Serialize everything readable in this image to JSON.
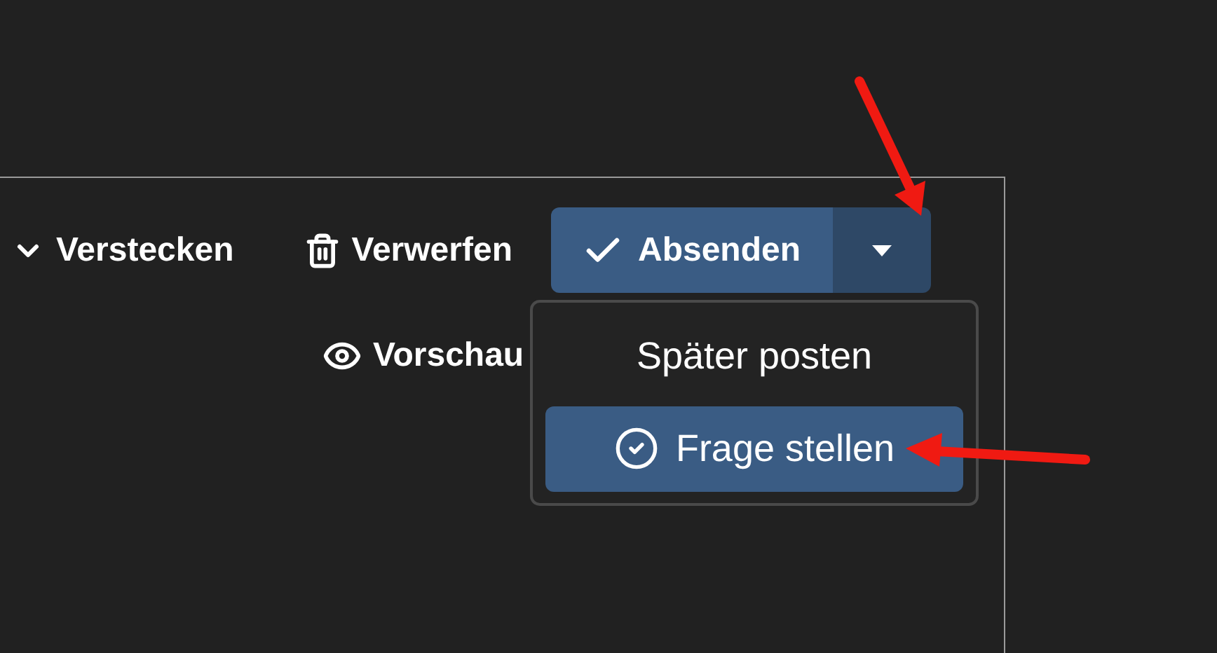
{
  "toolbar": [
    {
      "kind": "toggle",
      "label": "Verstecken"
    },
    {
      "kind": "discard",
      "label": "Verwerfen"
    },
    {
      "kind": "split",
      "label": "Absenden"
    }
  ],
  "preview": {
    "label": "Vorschau"
  },
  "submit_menu": {
    "expanded": true,
    "items": [
      {
        "label": "Später posten",
        "selected": false
      },
      {
        "label": "Frage stellen",
        "selected": true
      }
    ]
  }
}
